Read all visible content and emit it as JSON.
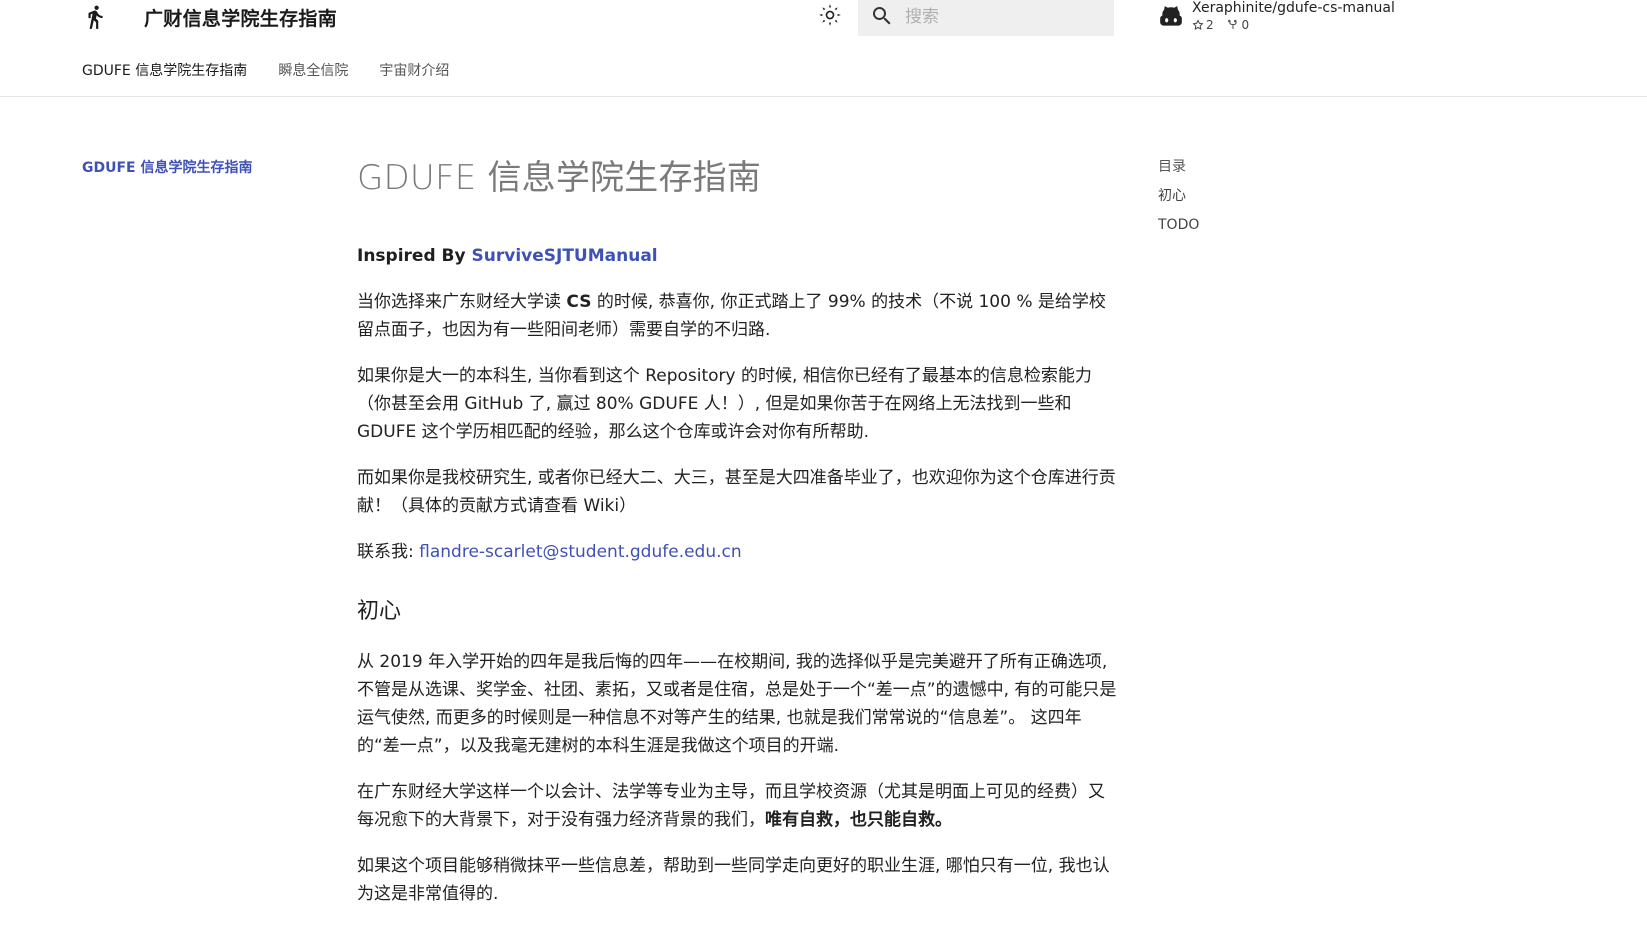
{
  "header": {
    "site_title": "广财信息学院生存指南",
    "search_placeholder": "搜索",
    "repo": {
      "name": "Xeraphinite/gdufe-cs-manual",
      "stars": "2",
      "forks": "0"
    },
    "tabs": [
      {
        "label": "GDUFE 信息学院生存指南",
        "active": true
      },
      {
        "label": "瞬息全信院",
        "active": false
      },
      {
        "label": "宇宙财介绍",
        "active": false
      }
    ]
  },
  "left_nav": {
    "items": [
      {
        "label": "GDUFE 信息学院生存指南",
        "active": true
      }
    ]
  },
  "toc": {
    "title": "目录",
    "items": [
      "初心",
      "TODO"
    ]
  },
  "article": {
    "title": "GDUFE 信息学院生存指南",
    "inspired_prefix": "Inspired By ",
    "inspired_link": "SurviveSJTUManual",
    "para1_a": "当你选择来广东财经大学读 ",
    "para1_b": "CS",
    "para1_c": " 的时候, 恭喜你, 你正式踏上了 99% 的技术（不说 100 % 是给学校留点面子，也因为有一些阳间老师）需要自学的不归路.",
    "para2": "如果你是大一的本科生, 当你看到这个 Repository 的时候, 相信你已经有了最基本的信息检索能力（你甚至会用 GitHub 了, 赢过 80% GDUFE 人！）, 但是如果你苦于在网络上无法找到一些和 GDUFE 这个学历相匹配的经验，那么这个仓库或许会对你有所帮助.",
    "para3": "而如果你是我校研究生, 或者你已经大二、大三，甚至是大四准备毕业了，也欢迎你为这个仓库进行贡献！（具体的贡献方式请查看 Wiki）",
    "contact_prefix": "联系我: ",
    "contact_email": "flandre-scarlet@student.gdufe.edu.cn",
    "h2_origin": "初心",
    "para4": "从 2019 年入学开始的四年是我后悔的四年——在校期间, 我的选择似乎是完美避开了所有正确选项, 不管是从选课、奖学金、社团、素拓，又或者是住宿，总是处于一个“差一点”的遗憾中, 有的可能只是运气使然, 而更多的时候则是一种信息不对等产生的结果, 也就是我们常常说的“信息差”。 这四年的“差一点”，以及我毫无建树的本科生涯是我做这个项目的开端.",
    "para5_a": "在广东财经大学这样一个以会计、法学等专业为主导，而且学校资源（尤其是明面上可见的经费）又每况愈下的大背景下，对于没有强力经济背景的我们，",
    "para5_b": "唯有自救，也只能自救。",
    "para6": "如果这个项目能够稍微抹平一些信息差，帮助到一些同学走向更好的职业生涯, 哪怕只有一位, 我也认为这是非常值得的."
  },
  "colors": {
    "accent": "#3f51b5",
    "title_gray": "#7a7a7a",
    "search_bg": "#efefef"
  }
}
